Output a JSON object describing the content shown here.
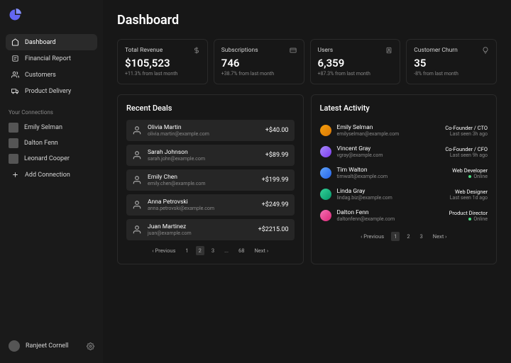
{
  "sidebar": {
    "nav": [
      {
        "label": "Dashboard",
        "icon": "home"
      },
      {
        "label": "Financial Report",
        "icon": "report"
      },
      {
        "label": "Customers",
        "icon": "users"
      },
      {
        "label": "Product Delivery",
        "icon": "truck"
      }
    ],
    "connections_label": "Your Connections",
    "connections": [
      {
        "name": "Emily Selman"
      },
      {
        "name": "Dalton Fenn"
      },
      {
        "name": "Leonard Cooper"
      }
    ],
    "add_connection": "Add Connection",
    "user": "Ranjeet Cornell"
  },
  "title": "Dashboard",
  "stats": [
    {
      "title": "Total Revenue",
      "value": "$105,523",
      "sub": "+11.3% from last month",
      "icon": "dollar"
    },
    {
      "title": "Subscriptions",
      "value": "746",
      "sub": "+38.7% from last month",
      "icon": "card"
    },
    {
      "title": "Users",
      "value": "6,359",
      "sub": "+87.3% from last month",
      "icon": "user"
    },
    {
      "title": "Customer Churn",
      "value": "35",
      "sub": "-8% from last month",
      "icon": "bulb"
    }
  ],
  "deals": {
    "title": "Recent Deals",
    "items": [
      {
        "name": "Olivia Martin",
        "email": "olivia.martin@example.com",
        "amount": "+$40.00"
      },
      {
        "name": "Sarah Johnson",
        "email": "sarah.john@example.com",
        "amount": "+$89.99"
      },
      {
        "name": "Emily Chen",
        "email": "emily.chen@example.com",
        "amount": "+$199.99"
      },
      {
        "name": "Anna Petrovski",
        "email": "anna.petrovski@example.com",
        "amount": "+$249.99"
      },
      {
        "name": "Juan Martinez",
        "email": "juan@example.com",
        "amount": "+$2215.00"
      }
    ],
    "pager": {
      "prev": "Previous",
      "pages": [
        "1",
        "2",
        "3",
        "...",
        "68"
      ],
      "current": "2",
      "next": "Next"
    }
  },
  "activity": {
    "title": "Latest Activity",
    "items": [
      {
        "name": "Emily Selman",
        "email": "emilyselman@example.com",
        "role": "Co-Founder / CTO",
        "status": "Last seen 3h ago",
        "online": false,
        "av": "av1"
      },
      {
        "name": "Vincent Gray",
        "email": "vgray@example.com",
        "role": "Co-Founder / CFO",
        "status": "Last seen 9h ago",
        "online": false,
        "av": "av2"
      },
      {
        "name": "Tim Walton",
        "email": "timwalt@example.com",
        "role": "Web Developer",
        "status": "Online",
        "online": true,
        "av": "av3"
      },
      {
        "name": "Linda Gray",
        "email": "lindag.biz@example.com",
        "role": "Web Designer",
        "status": "Last seen 1d ago",
        "online": false,
        "av": "av4"
      },
      {
        "name": "Dalton Fenn",
        "email": "daltonfenn@example.com",
        "role": "Product Director",
        "status": "Online",
        "online": true,
        "av": "av5"
      }
    ],
    "pager": {
      "prev": "Previous",
      "pages": [
        "1",
        "2",
        "3"
      ],
      "current": "1",
      "next": "Next"
    }
  }
}
